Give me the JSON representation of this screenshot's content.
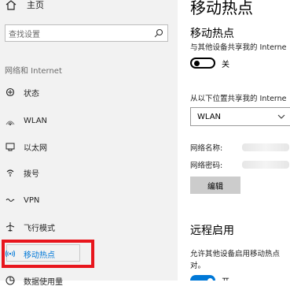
{
  "sidebar": {
    "home_label": "主页",
    "search_placeholder": "查找设置",
    "category": "网络和 Internet",
    "items": [
      {
        "label": "状态",
        "icon": "home-status-icon"
      },
      {
        "label": "WLAN",
        "icon": "wifi-icon"
      },
      {
        "label": "以太网",
        "icon": "ethernet-icon"
      },
      {
        "label": "拨号",
        "icon": "dialup-icon"
      },
      {
        "label": "VPN",
        "icon": "vpn-icon"
      },
      {
        "label": "飞行模式",
        "icon": "airplane-icon"
      },
      {
        "label": "移动热点",
        "icon": "hotspot-icon",
        "active": true
      },
      {
        "label": "数据使用量",
        "icon": "data-usage-icon"
      }
    ]
  },
  "main": {
    "page_title": "移动热点",
    "hotspot": {
      "title": "移动热点",
      "description": "与其他设备共享我的 Interne",
      "toggle_state": "关"
    },
    "share_from": {
      "label": "从以下位置共享我的 Interne",
      "selected": "WLAN"
    },
    "network_name_label": "网络名称:",
    "network_password_label": "网络密码:",
    "edit_label": "编辑",
    "remote": {
      "title": "远程启用",
      "description_line1": "允许其他设备启用移动热点",
      "description_line2": "对。",
      "toggle_state": "开"
    }
  },
  "colors": {
    "accent": "#0078d7",
    "highlight_border": "#e8161d",
    "sidebar_bg": "#f2f2f2"
  }
}
